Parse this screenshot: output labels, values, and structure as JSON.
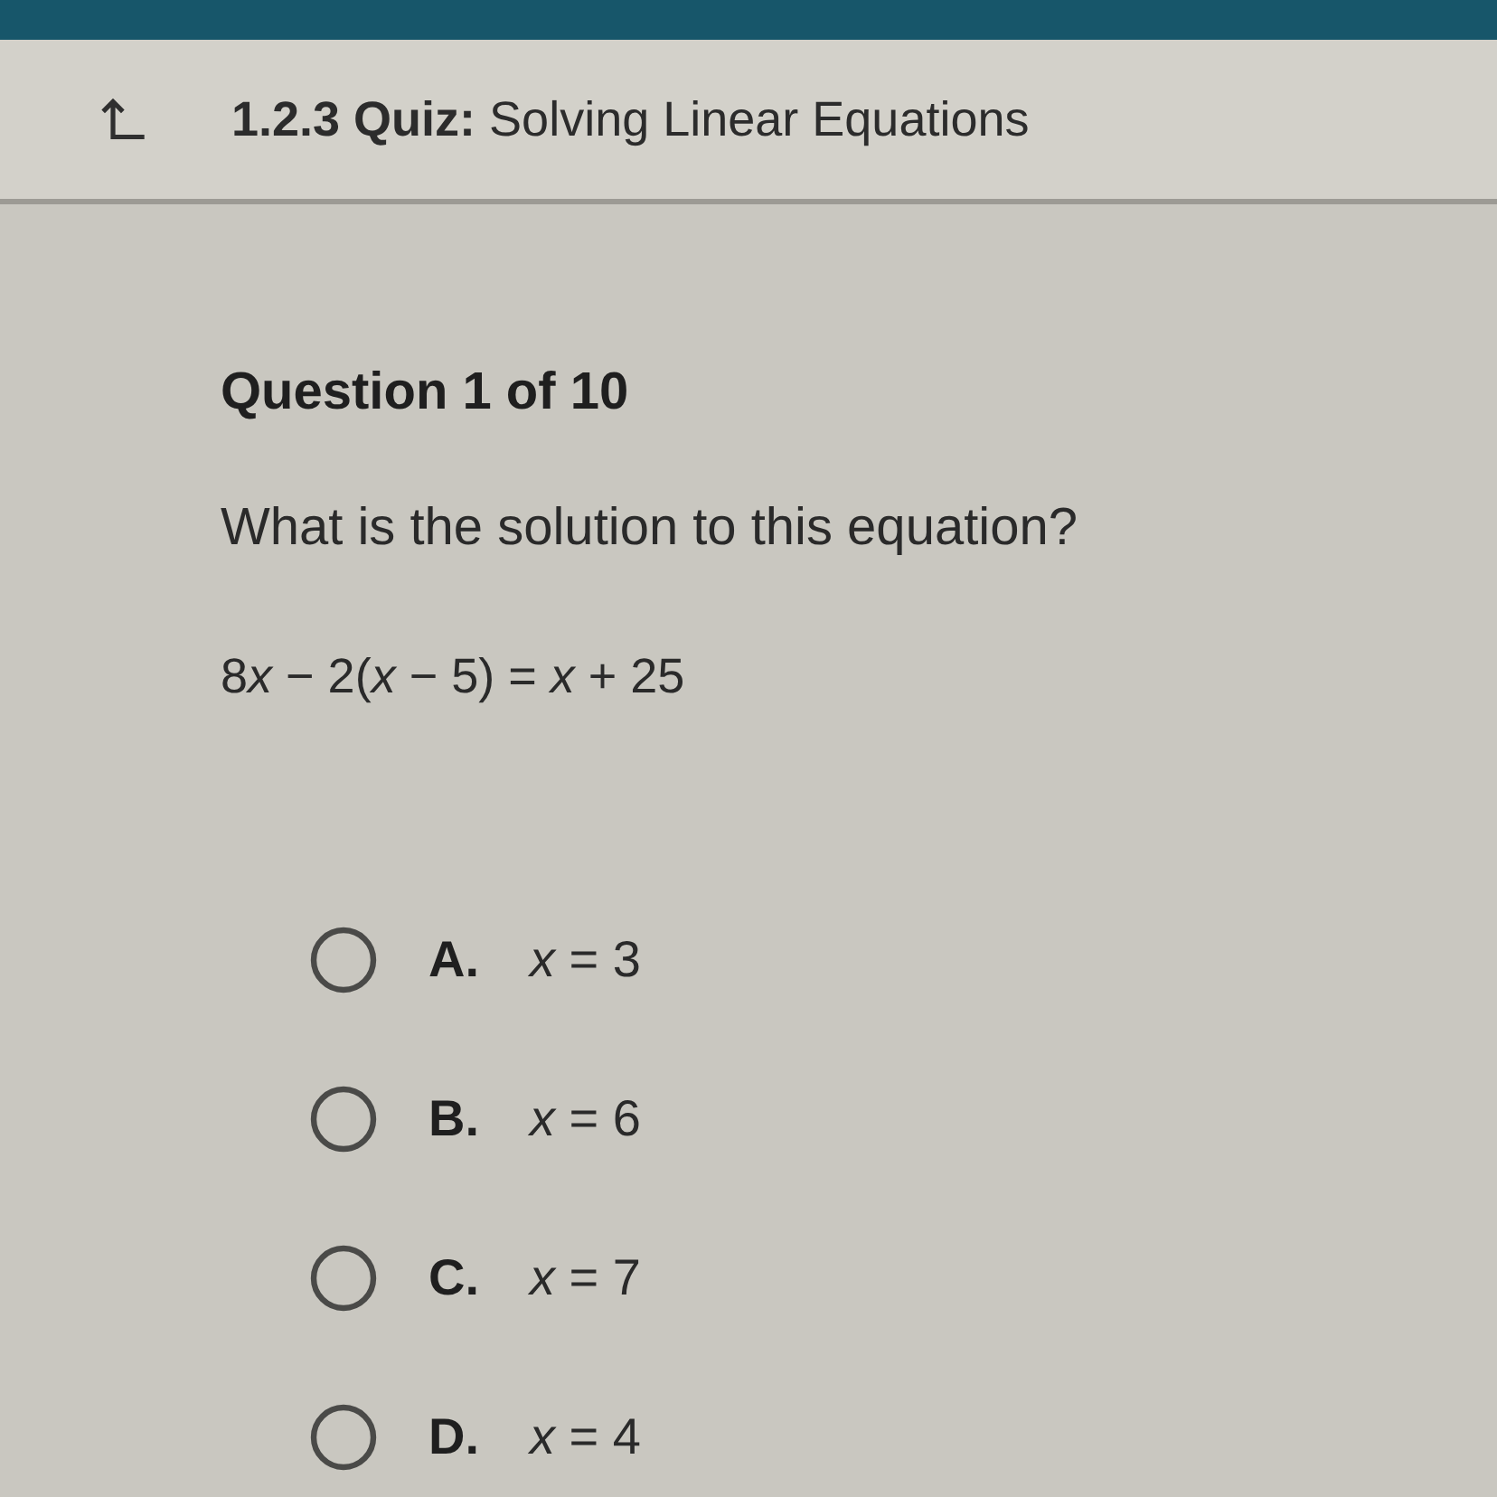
{
  "header": {
    "title": "**1.2.3 Quiz:** Solving Linear Equations"
  },
  "question": {
    "heading": "Question 1 of 10",
    "prompt": "What is the solution to this equation?",
    "equation": "8x − 2(x − 5) = x + 25"
  },
  "options": [
    {
      "letter": "A.",
      "text": "x = 3",
      "selected": false
    },
    {
      "letter": "B.",
      "text": "x = 6",
      "selected": false
    },
    {
      "letter": "C.",
      "text": "x = 7",
      "selected": false
    },
    {
      "letter": "D.",
      "text": "x = 4",
      "selected": false
    }
  ]
}
